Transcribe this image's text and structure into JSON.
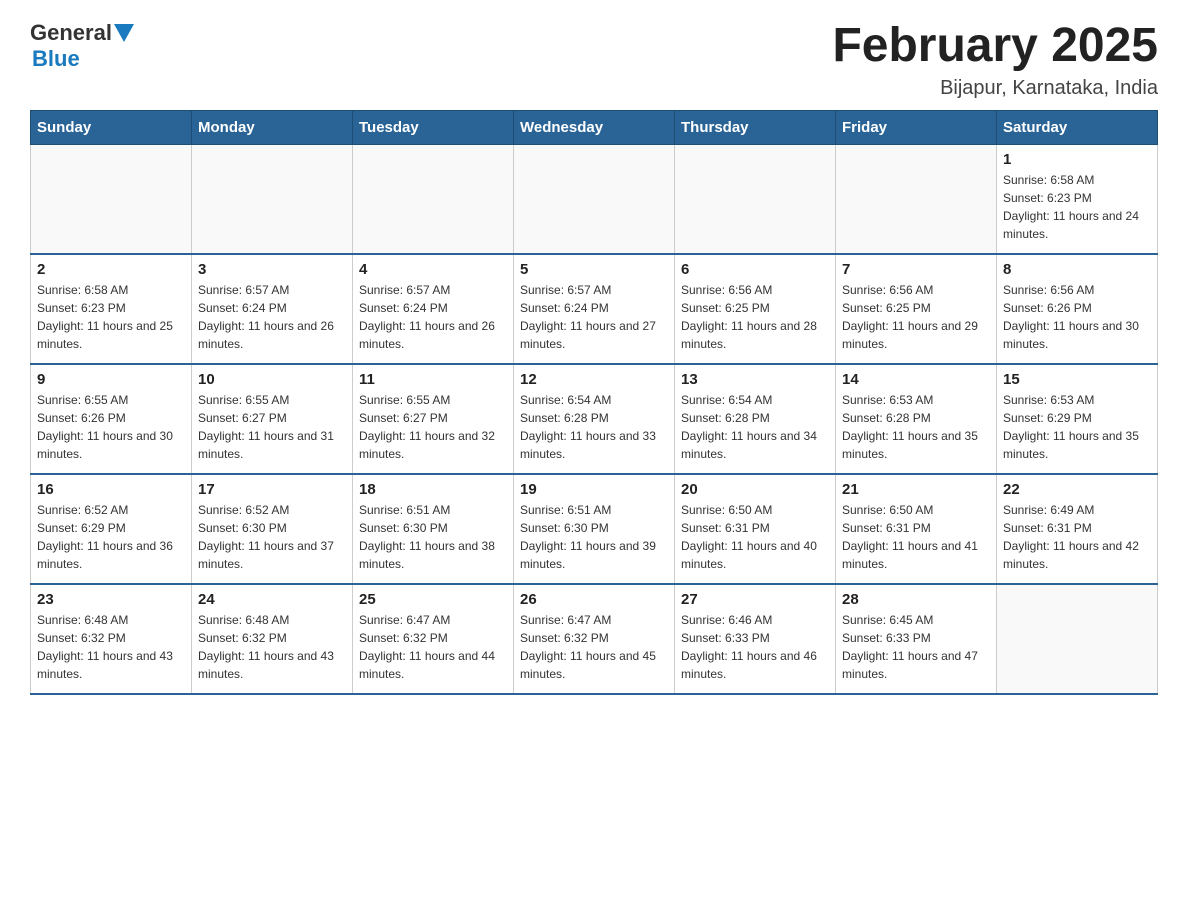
{
  "logo": {
    "text_general": "General",
    "text_blue": "Blue"
  },
  "header": {
    "month_title": "February 2025",
    "location": "Bijapur, Karnataka, India"
  },
  "days_of_week": [
    "Sunday",
    "Monday",
    "Tuesday",
    "Wednesday",
    "Thursday",
    "Friday",
    "Saturday"
  ],
  "weeks": [
    [
      {
        "day": "",
        "sunrise": "",
        "sunset": "",
        "daylight": ""
      },
      {
        "day": "",
        "sunrise": "",
        "sunset": "",
        "daylight": ""
      },
      {
        "day": "",
        "sunrise": "",
        "sunset": "",
        "daylight": ""
      },
      {
        "day": "",
        "sunrise": "",
        "sunset": "",
        "daylight": ""
      },
      {
        "day": "",
        "sunrise": "",
        "sunset": "",
        "daylight": ""
      },
      {
        "day": "",
        "sunrise": "",
        "sunset": "",
        "daylight": ""
      },
      {
        "day": "1",
        "sunrise": "Sunrise: 6:58 AM",
        "sunset": "Sunset: 6:23 PM",
        "daylight": "Daylight: 11 hours and 24 minutes."
      }
    ],
    [
      {
        "day": "2",
        "sunrise": "Sunrise: 6:58 AM",
        "sunset": "Sunset: 6:23 PM",
        "daylight": "Daylight: 11 hours and 25 minutes."
      },
      {
        "day": "3",
        "sunrise": "Sunrise: 6:57 AM",
        "sunset": "Sunset: 6:24 PM",
        "daylight": "Daylight: 11 hours and 26 minutes."
      },
      {
        "day": "4",
        "sunrise": "Sunrise: 6:57 AM",
        "sunset": "Sunset: 6:24 PM",
        "daylight": "Daylight: 11 hours and 26 minutes."
      },
      {
        "day": "5",
        "sunrise": "Sunrise: 6:57 AM",
        "sunset": "Sunset: 6:24 PM",
        "daylight": "Daylight: 11 hours and 27 minutes."
      },
      {
        "day": "6",
        "sunrise": "Sunrise: 6:56 AM",
        "sunset": "Sunset: 6:25 PM",
        "daylight": "Daylight: 11 hours and 28 minutes."
      },
      {
        "day": "7",
        "sunrise": "Sunrise: 6:56 AM",
        "sunset": "Sunset: 6:25 PM",
        "daylight": "Daylight: 11 hours and 29 minutes."
      },
      {
        "day": "8",
        "sunrise": "Sunrise: 6:56 AM",
        "sunset": "Sunset: 6:26 PM",
        "daylight": "Daylight: 11 hours and 30 minutes."
      }
    ],
    [
      {
        "day": "9",
        "sunrise": "Sunrise: 6:55 AM",
        "sunset": "Sunset: 6:26 PM",
        "daylight": "Daylight: 11 hours and 30 minutes."
      },
      {
        "day": "10",
        "sunrise": "Sunrise: 6:55 AM",
        "sunset": "Sunset: 6:27 PM",
        "daylight": "Daylight: 11 hours and 31 minutes."
      },
      {
        "day": "11",
        "sunrise": "Sunrise: 6:55 AM",
        "sunset": "Sunset: 6:27 PM",
        "daylight": "Daylight: 11 hours and 32 minutes."
      },
      {
        "day": "12",
        "sunrise": "Sunrise: 6:54 AM",
        "sunset": "Sunset: 6:28 PM",
        "daylight": "Daylight: 11 hours and 33 minutes."
      },
      {
        "day": "13",
        "sunrise": "Sunrise: 6:54 AM",
        "sunset": "Sunset: 6:28 PM",
        "daylight": "Daylight: 11 hours and 34 minutes."
      },
      {
        "day": "14",
        "sunrise": "Sunrise: 6:53 AM",
        "sunset": "Sunset: 6:28 PM",
        "daylight": "Daylight: 11 hours and 35 minutes."
      },
      {
        "day": "15",
        "sunrise": "Sunrise: 6:53 AM",
        "sunset": "Sunset: 6:29 PM",
        "daylight": "Daylight: 11 hours and 35 minutes."
      }
    ],
    [
      {
        "day": "16",
        "sunrise": "Sunrise: 6:52 AM",
        "sunset": "Sunset: 6:29 PM",
        "daylight": "Daylight: 11 hours and 36 minutes."
      },
      {
        "day": "17",
        "sunrise": "Sunrise: 6:52 AM",
        "sunset": "Sunset: 6:30 PM",
        "daylight": "Daylight: 11 hours and 37 minutes."
      },
      {
        "day": "18",
        "sunrise": "Sunrise: 6:51 AM",
        "sunset": "Sunset: 6:30 PM",
        "daylight": "Daylight: 11 hours and 38 minutes."
      },
      {
        "day": "19",
        "sunrise": "Sunrise: 6:51 AM",
        "sunset": "Sunset: 6:30 PM",
        "daylight": "Daylight: 11 hours and 39 minutes."
      },
      {
        "day": "20",
        "sunrise": "Sunrise: 6:50 AM",
        "sunset": "Sunset: 6:31 PM",
        "daylight": "Daylight: 11 hours and 40 minutes."
      },
      {
        "day": "21",
        "sunrise": "Sunrise: 6:50 AM",
        "sunset": "Sunset: 6:31 PM",
        "daylight": "Daylight: 11 hours and 41 minutes."
      },
      {
        "day": "22",
        "sunrise": "Sunrise: 6:49 AM",
        "sunset": "Sunset: 6:31 PM",
        "daylight": "Daylight: 11 hours and 42 minutes."
      }
    ],
    [
      {
        "day": "23",
        "sunrise": "Sunrise: 6:48 AM",
        "sunset": "Sunset: 6:32 PM",
        "daylight": "Daylight: 11 hours and 43 minutes."
      },
      {
        "day": "24",
        "sunrise": "Sunrise: 6:48 AM",
        "sunset": "Sunset: 6:32 PM",
        "daylight": "Daylight: 11 hours and 43 minutes."
      },
      {
        "day": "25",
        "sunrise": "Sunrise: 6:47 AM",
        "sunset": "Sunset: 6:32 PM",
        "daylight": "Daylight: 11 hours and 44 minutes."
      },
      {
        "day": "26",
        "sunrise": "Sunrise: 6:47 AM",
        "sunset": "Sunset: 6:32 PM",
        "daylight": "Daylight: 11 hours and 45 minutes."
      },
      {
        "day": "27",
        "sunrise": "Sunrise: 6:46 AM",
        "sunset": "Sunset: 6:33 PM",
        "daylight": "Daylight: 11 hours and 46 minutes."
      },
      {
        "day": "28",
        "sunrise": "Sunrise: 6:45 AM",
        "sunset": "Sunset: 6:33 PM",
        "daylight": "Daylight: 11 hours and 47 minutes."
      },
      {
        "day": "",
        "sunrise": "",
        "sunset": "",
        "daylight": ""
      }
    ]
  ]
}
